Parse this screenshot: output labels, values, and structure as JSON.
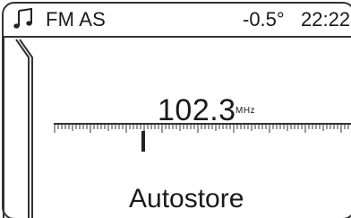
{
  "status": {
    "icon": "music-note-icon",
    "band": "FM AS",
    "temperature": "-0.5°",
    "time": "22:22"
  },
  "tuner": {
    "frequency": "102.3",
    "unit": "MHz",
    "band_position": 0.3
  },
  "menu": {
    "item": "Autostore"
  }
}
